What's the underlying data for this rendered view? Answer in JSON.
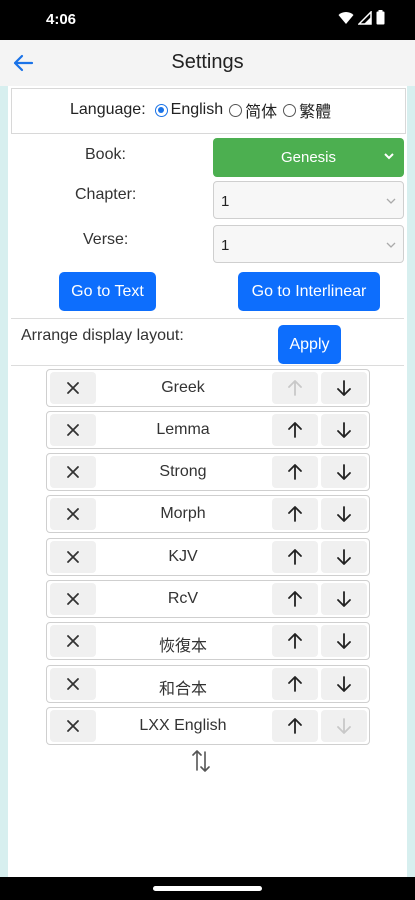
{
  "status_bar": {
    "time": "4:06"
  },
  "app_bar": {
    "title": "Settings"
  },
  "language": {
    "label": "Language:",
    "options": [
      {
        "label": "English",
        "selected": true
      },
      {
        "label": "简体",
        "selected": false
      },
      {
        "label": "繁體",
        "selected": false
      }
    ]
  },
  "form": {
    "book_label": "Book:",
    "book_value": "Genesis",
    "chapter_label": "Chapter:",
    "chapter_value": "1",
    "verse_label": "Verse:",
    "verse_value": "1"
  },
  "buttons": {
    "go_text": "Go to Text",
    "go_interlinear": "Go to Interlinear",
    "apply": "Apply"
  },
  "layout": {
    "label": "Arrange display layout:",
    "rows": [
      {
        "name": "Greek",
        "up_enabled": false,
        "down_enabled": true
      },
      {
        "name": "Lemma",
        "up_enabled": true,
        "down_enabled": true
      },
      {
        "name": "Strong",
        "up_enabled": true,
        "down_enabled": true
      },
      {
        "name": "Morph",
        "up_enabled": true,
        "down_enabled": true
      },
      {
        "name": "KJV",
        "up_enabled": true,
        "down_enabled": true
      },
      {
        "name": "RcV",
        "up_enabled": true,
        "down_enabled": true
      },
      {
        "name": "恢復本",
        "up_enabled": true,
        "down_enabled": true
      },
      {
        "name": "和合本",
        "up_enabled": true,
        "down_enabled": true
      },
      {
        "name": "LXX English",
        "up_enabled": true,
        "down_enabled": false
      }
    ]
  },
  "colors": {
    "accent_blue": "#0d6efd",
    "book_green": "#4caf50",
    "frame_teal": "#d7efef"
  }
}
